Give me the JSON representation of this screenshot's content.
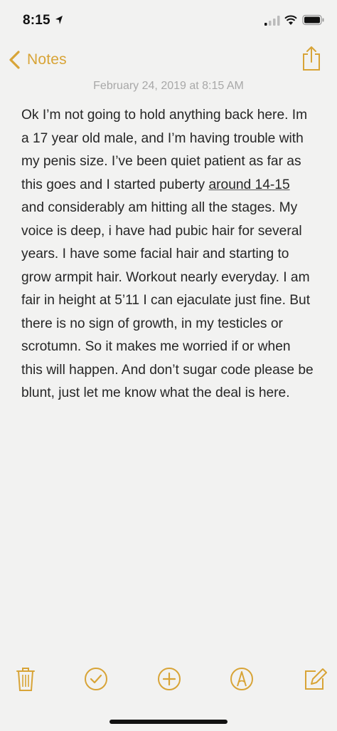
{
  "status_bar": {
    "time": "8:15",
    "icons": [
      "location-arrow-icon",
      "cellular-signal-icon",
      "wifi-icon",
      "battery-icon"
    ]
  },
  "nav": {
    "back_label": "Notes",
    "share_icon": "share-icon"
  },
  "note": {
    "date": "February 24, 2019 at 8:15 AM",
    "body_before_link": "Ok I’m not going to hold anything back here. Im a 17 year old male, and I’m having trouble with my penis size. I’ve been quiet patient as far as this goes and I started puberty ",
    "body_link": "around 14-15",
    "body_after_link": " and considerably am hitting all the stages. My voice is deep, i have had pubic hair for several years. I have some facial hair and starting to grow armpit hair. Workout nearly everyday. I am fair in height at 5’11 I can ejaculate just fine. But there is no sign of growth, in my testicles or scrotumn.  So it makes me worried if or when this will happen. And don’t sugar code please be blunt, just let me know what the deal is here."
  },
  "toolbar": {
    "icons": [
      "trash-icon",
      "checklist-icon",
      "add-icon",
      "markup-icon",
      "compose-icon"
    ]
  },
  "colors": {
    "accent": "#d8a437",
    "background": "#f2f2f1",
    "date_text": "#a8a8a8",
    "body_text": "#262626"
  }
}
